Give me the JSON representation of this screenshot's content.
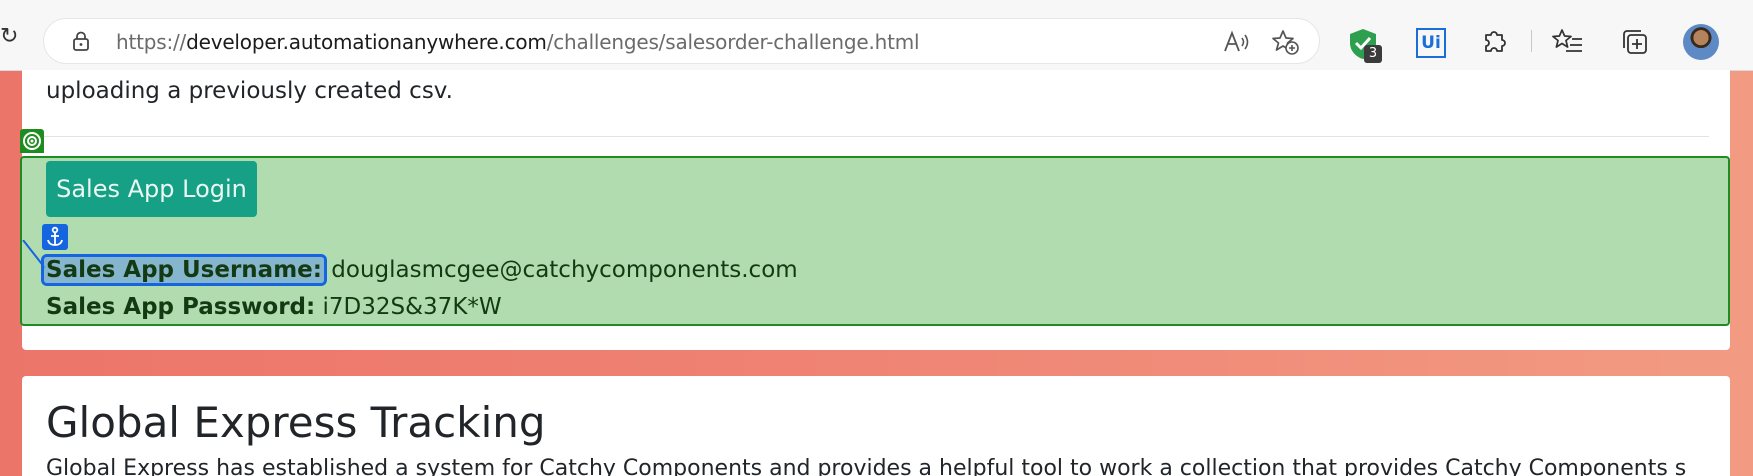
{
  "browser": {
    "url_scheme": "https://",
    "url_host": "developer.automationanywhere.com",
    "url_path": "/challenges/salesorder-challenge.html",
    "extension_badge_count": "3",
    "extension_ui_label": "Ui",
    "icons": [
      "reload-icon",
      "lock-icon",
      "read-aloud-icon",
      "favorite-add-icon",
      "shield-check-icon",
      "uipath-extension-icon",
      "extensions-icon",
      "favorites-icon",
      "collections-icon",
      "profile-avatar"
    ]
  },
  "page": {
    "intro_text": "uploading a previously created csv.",
    "login_button_label": "Sales App Login",
    "username_label": "Sales App Username:",
    "username_value": "douglasmcgee@catchycomponents.com",
    "password_label": "Sales App Password:",
    "password_value": "i7D32S&37K*W",
    "section_title": "Global Express Tracking",
    "section_snippet": "Global Express has established a system for Catchy Components and provides a helpful tool to work a collection that provides Catchy Components status"
  },
  "colors": {
    "highlight_fill": "#a0d49e",
    "highlight_border": "#1e8c1e",
    "anchor_blue": "#1565e0",
    "button_teal": "#16a085"
  }
}
